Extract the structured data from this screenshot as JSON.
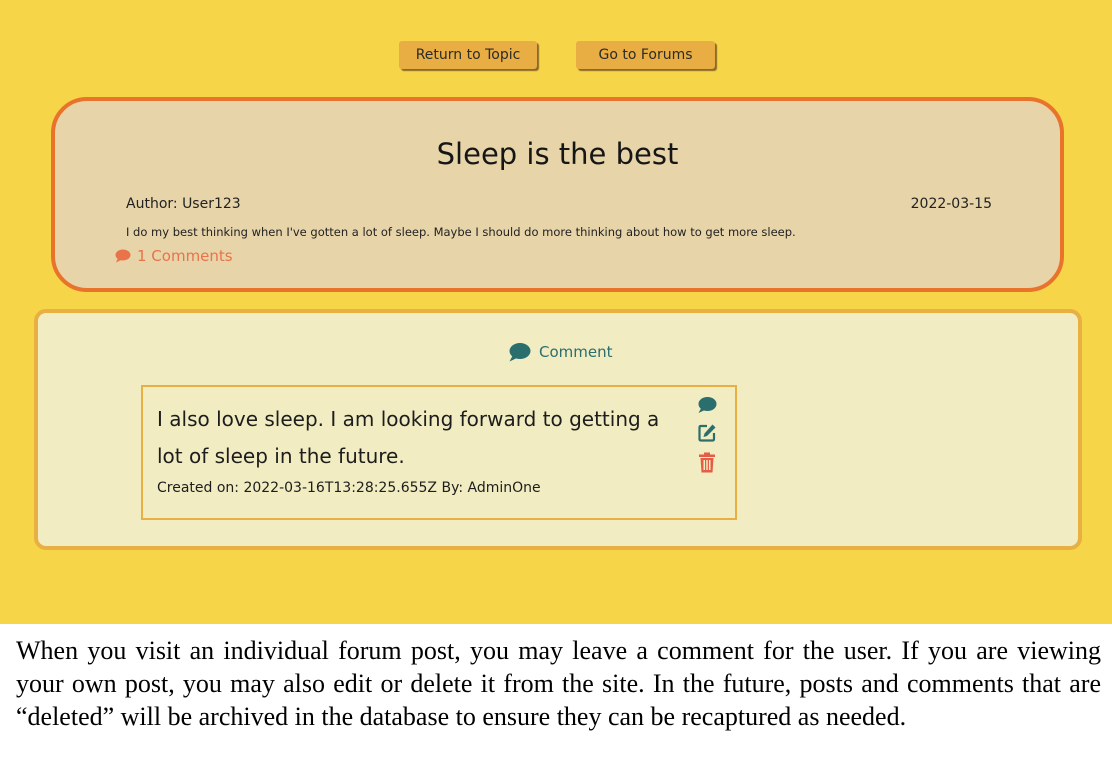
{
  "nav": {
    "return_label": "Return to Topic",
    "forums_label": "Go to Forums"
  },
  "post": {
    "title": "Sleep is the best",
    "author_label": "Author:",
    "author_name": "User123",
    "date": "2022-03-15",
    "body": "I do my best thinking when I've gotten a lot of sleep. Maybe I should do more thinking about how to get more sleep.",
    "comments_count": "1 Comments",
    "comments_icon": "comment-icon"
  },
  "comment_section": {
    "action_label": "Comment",
    "action_icon": "comment-icon",
    "comments": [
      {
        "text": "I also love sleep. I am looking forward to getting a lot of sleep in the future.",
        "meta": "Created on: 2022-03-16T13:28:25.655Z By: AdminOne",
        "icons": [
          "reply-comment-icon",
          "edit-icon",
          "trash-icon"
        ]
      }
    ]
  },
  "caption": "When you visit an individual forum post, you may leave a comment for the user. If you are viewing your own post, you may also edit or delete it from the site. In the future, posts and comments that are “deleted” will be archived in the database to ensure they can be recaptured as needed.",
  "colors": {
    "page_background": "#f7d548",
    "post_card": "#e7d4a9",
    "post_border": "#e9732b",
    "comment_section": "#f1ecc1",
    "comment_border": "#e8b043",
    "teal_accent": "#2a6e6e",
    "delete_red": "#e45d45",
    "comments_link": "#e9734a",
    "button": "#e8ad43"
  }
}
